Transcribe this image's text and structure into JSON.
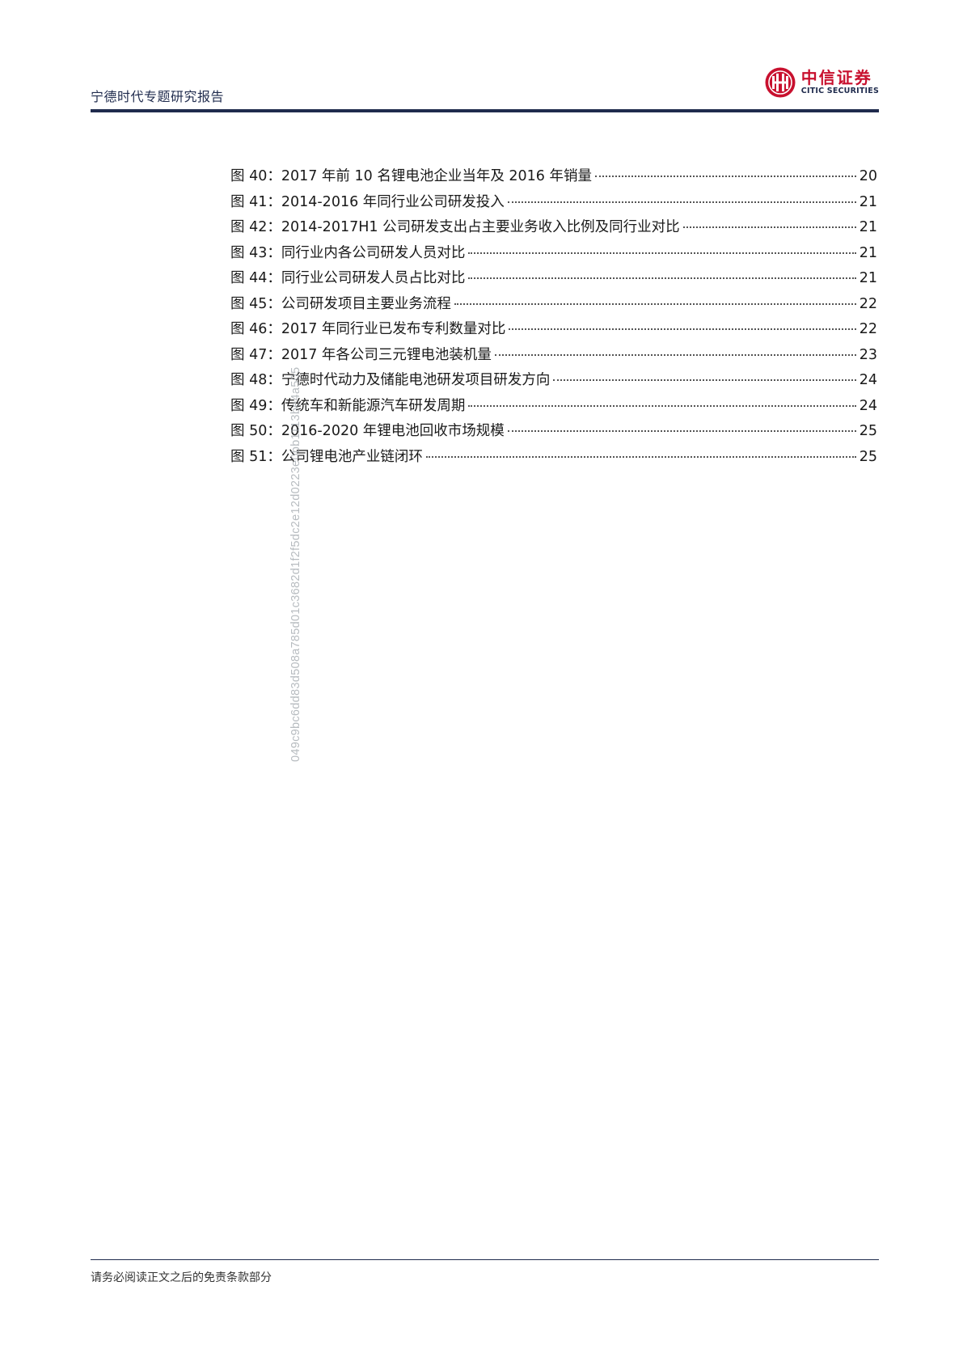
{
  "header": {
    "title": "宁德时代专题研究报告",
    "logo_cn": "中信证券",
    "logo_en": "CITIC SECURITIES",
    "brand_color": "#c8102e",
    "rule_color": "#1f2b4d"
  },
  "toc": {
    "items": [
      {
        "label": "图 40：2017 年前 10 名锂电池企业当年及 2016 年销量",
        "page": "20"
      },
      {
        "label": "图 41：2014-2016 年同行业公司研发投入",
        "page": "21"
      },
      {
        "label": "图 42：2014-2017H1 公司研发支出占主要业务收入比例及同行业对比",
        "page": "21"
      },
      {
        "label": "图 43：同行业内各公司研发人员对比",
        "page": "21"
      },
      {
        "label": "图 44：同行业公司研发人员占比对比",
        "page": "21"
      },
      {
        "label": "图 45：公司研发项目主要业务流程",
        "page": "22"
      },
      {
        "label": "图 46：2017 年同行业已发布专利数量对比",
        "page": "22"
      },
      {
        "label": "图 47：2017 年各公司三元锂电池装机量",
        "page": "23"
      },
      {
        "label": "图 48：宁德时代动力及储能电池研发项目研发方向",
        "page": "24"
      },
      {
        "label": "图 49：传统车和新能源汽车研发周期",
        "page": "24"
      },
      {
        "label": "图 50：2016-2020 年锂电池回收市场规模",
        "page": "25"
      },
      {
        "label": "图 51：公司锂电池产业链闭环",
        "page": "25"
      }
    ]
  },
  "watermark": "049c9bc6dd83d508a785d01c3682d1f2f5dc2e12d0223e0bb1113be4a505",
  "footer": {
    "disclaimer": "请务必阅读正文之后的免责条款部分"
  }
}
